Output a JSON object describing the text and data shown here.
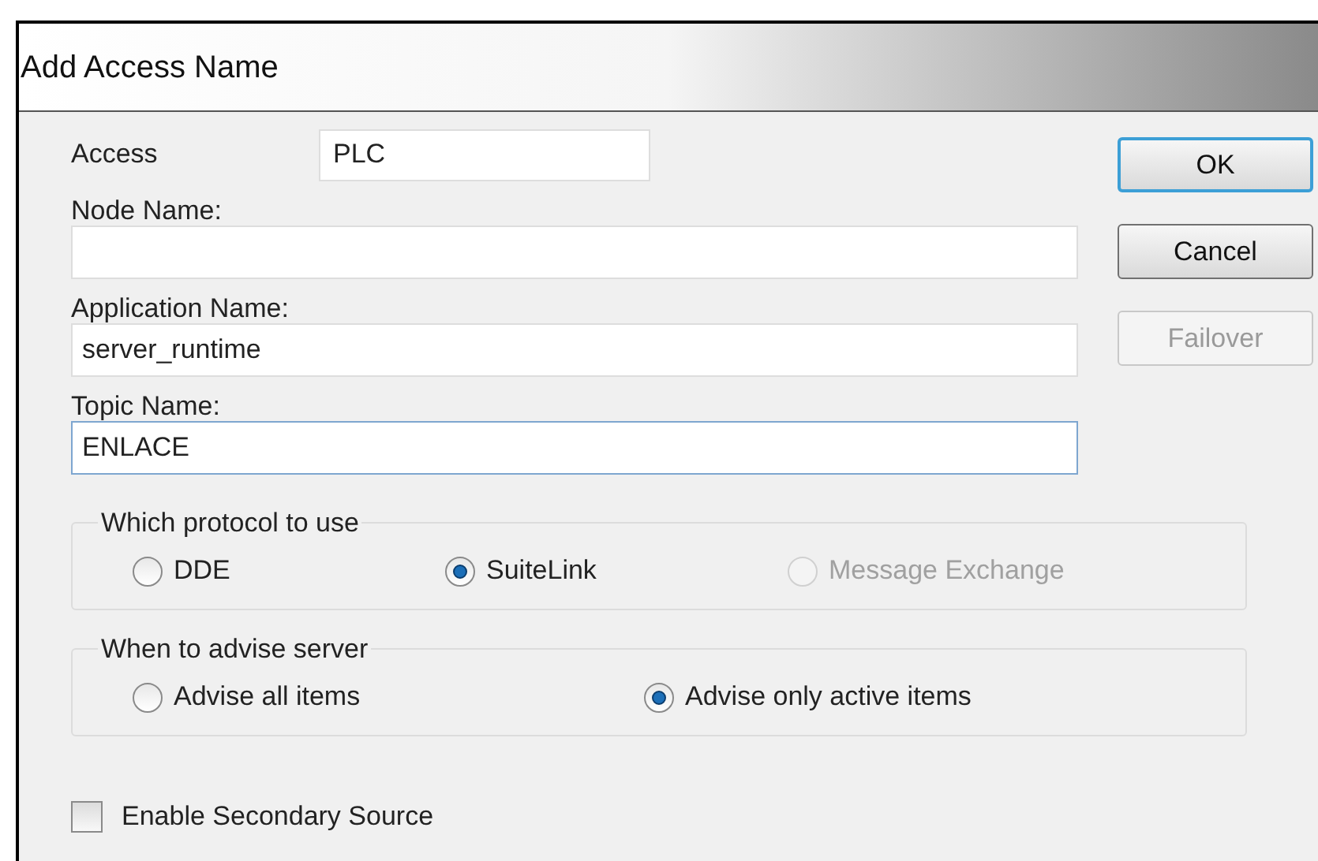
{
  "window": {
    "title": "Add Access Name"
  },
  "access": {
    "label": "Access",
    "value": "PLC"
  },
  "fields": [
    {
      "label": "Node Name:",
      "focused": false
    },
    {
      "label": "Application Name:",
      "value": "server_runtime",
      "focused": false
    },
    {
      "label": "Topic Name:",
      "value": "ENLACE",
      "focused": true
    }
  ],
  "buttons": [
    {
      "label": "OK",
      "default": true,
      "disabled": false
    },
    {
      "label": "Cancel",
      "default": false,
      "disabled": false
    },
    {
      "label": "Failover",
      "default": false,
      "disabled": true
    }
  ],
  "groups": [
    {
      "legend": "Which protocol to use",
      "options": [
        {
          "label": "DDE",
          "selected": false,
          "disabled": false
        },
        {
          "label": "SuiteLink",
          "selected": true,
          "disabled": false
        },
        {
          "label": "Message Exchange",
          "selected": false,
          "disabled": true
        }
      ]
    },
    {
      "legend": "When to advise server",
      "options": [
        {
          "label": "Advise all items",
          "selected": false,
          "disabled": false
        },
        {
          "label": "Advise only active items",
          "selected": true,
          "disabled": false
        }
      ]
    }
  ],
  "secondary_source": {
    "label": "Enable Secondary Source",
    "checked": false
  }
}
